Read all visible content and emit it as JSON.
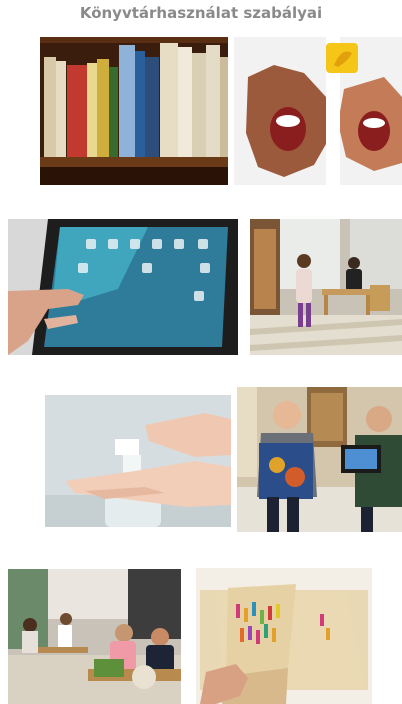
{
  "page": {
    "title": "Könyvtárhasználat szabályai"
  },
  "photos": [
    {
      "name": "bookshelf-photo"
    },
    {
      "name": "shouting-faces-photo"
    },
    {
      "name": "tablet-touch-photo"
    },
    {
      "name": "library-children-photo"
    },
    {
      "name": "hand-sanitizer-photo"
    },
    {
      "name": "boys-with-books-photo"
    },
    {
      "name": "children-reading-table-photo"
    },
    {
      "name": "old-book-page-photo"
    }
  ],
  "colors": {
    "title": "#8a8a8a"
  }
}
